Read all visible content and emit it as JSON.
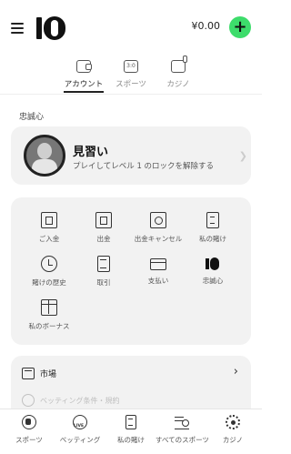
{
  "header": {
    "balance": "¥0.00",
    "add_label": "+"
  },
  "tabs": [
    {
      "label": "アカウント",
      "icon": "wallet-icon",
      "active": true
    },
    {
      "label": "スポーツ",
      "icon": "scoreboard-icon",
      "active": false
    },
    {
      "label": "カジノ",
      "icon": "slot-machine-icon",
      "active": false
    }
  ],
  "loyalty": {
    "section_label": "忠誠心",
    "level_title": "見習い",
    "level_description": "プレイしてレベル 1 のロックを解除する"
  },
  "grid": [
    {
      "label": "ご入金",
      "icon": "atm-deposit-icon"
    },
    {
      "label": "出金",
      "icon": "atm-withdraw-icon"
    },
    {
      "label": "出金キャンセル",
      "icon": "withdraw-cancel-icon"
    },
    {
      "label": "私の賭け",
      "icon": "receipt-icon"
    },
    {
      "label": "賭けの歴史",
      "icon": "history-icon"
    },
    {
      "label": "取引",
      "icon": "document-icon"
    },
    {
      "label": "支払い",
      "icon": "card-icon"
    },
    {
      "label": "忠誠心",
      "icon": "loyalty-logo-icon"
    },
    {
      "label": "私のボーナス",
      "icon": "gift-icon"
    }
  ],
  "list": [
    {
      "label": "市場",
      "icon": "market-icon"
    },
    {
      "label": "ベッティング条件・規約",
      "icon": "info-icon"
    }
  ],
  "bottom_nav": [
    {
      "label": "スポーツ",
      "icon": "sports-icon"
    },
    {
      "label": "ベッティング",
      "icon": "live-icon"
    },
    {
      "label": "私の賭け",
      "icon": "bets-icon"
    },
    {
      "label": "すべてのスポーツ",
      "icon": "all-sports-icon"
    },
    {
      "label": "カジノ",
      "icon": "casino-chip-icon"
    }
  ],
  "colors": {
    "accent_green": "#3ddc6b",
    "card_bg": "#f2f2f2"
  }
}
